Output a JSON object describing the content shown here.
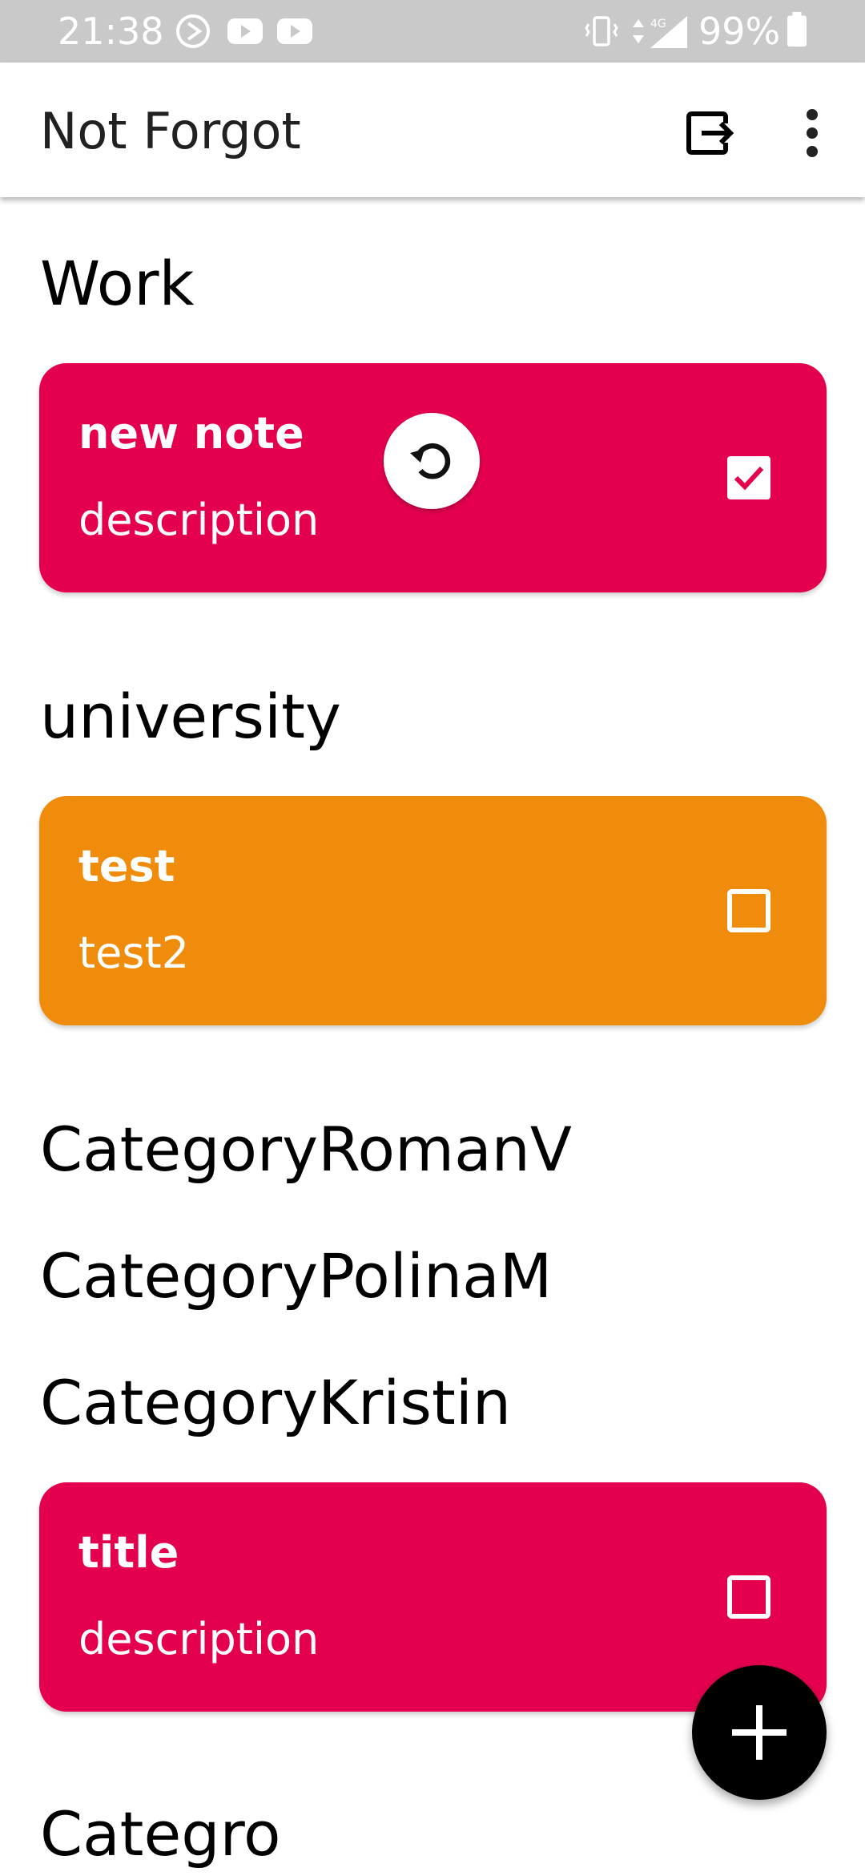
{
  "status_bar": {
    "time": "21:38",
    "battery_percent": "99%",
    "network": "4G",
    "icons": [
      "media-cast-icon",
      "youtube-icon",
      "youtube-icon",
      "vibrate-icon",
      "data-arrows-icon",
      "signal-icon",
      "battery-icon"
    ]
  },
  "app_bar": {
    "title": "Not Forgot",
    "actions": [
      "logout-icon",
      "more-vert-icon"
    ]
  },
  "categories": [
    {
      "name": "Work",
      "notes": [
        {
          "title": "new note",
          "description": "description",
          "checked": true,
          "color": "#E5004F",
          "restore_icon": "refresh-icon"
        }
      ]
    },
    {
      "name": "university",
      "notes": [
        {
          "title": "test",
          "description": "test2",
          "checked": false,
          "color": "#F08C0C"
        }
      ]
    },
    {
      "name": "CategoryRomanV",
      "notes": []
    },
    {
      "name": "CategoryPolinaM",
      "notes": []
    },
    {
      "name": "CategoryKristin",
      "notes": [
        {
          "title": "title",
          "description": "description",
          "checked": false,
          "color": "#E5004F"
        }
      ]
    },
    {
      "name": "Categro",
      "notes": []
    }
  ],
  "fab": {
    "icon": "plus-icon"
  },
  "colors": {
    "status_bar": "#C9C9C9",
    "card_pink": "#E5004F",
    "card_orange": "#F08C0C",
    "fab": "#000000"
  }
}
